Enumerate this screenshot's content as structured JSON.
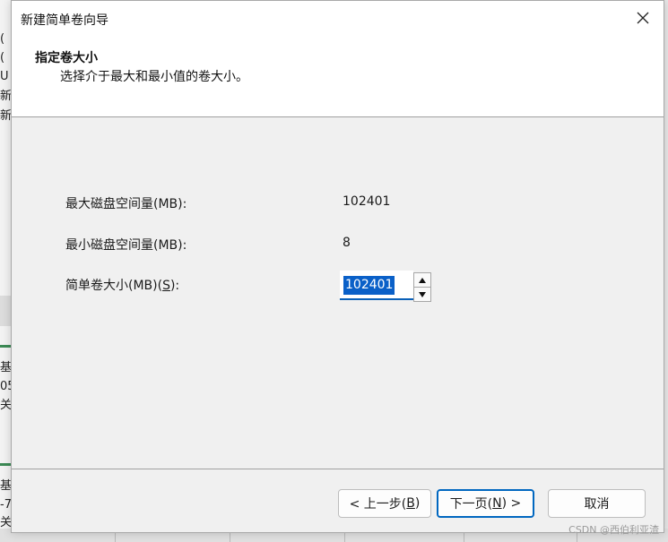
{
  "background": {
    "fragments": [
      "(",
      "(",
      "U",
      "新",
      "新",
      "基",
      "05",
      "关",
      "基",
      "-7",
      "关"
    ],
    "watermark": "CSDN @西伯利亚渣"
  },
  "dialog": {
    "title": "新建简单卷向导",
    "heading": "指定卷大小",
    "subheading": "选择介于最大和最小值的卷大小。",
    "max_label": "最大磁盘空间量(MB):",
    "max_value": "102401",
    "min_label": "最小磁盘空间量(MB):",
    "min_value": "8",
    "size_label_main": "简单卷大小(MB)(",
    "size_label_accel": "S",
    "size_label_end": "):",
    "size_value": "102401",
    "back_button": "< 上一步(",
    "back_accel": "B",
    "back_end": ")",
    "next_button": "下一页(",
    "next_accel": "N",
    "next_end": ") >",
    "cancel_button": "取消"
  },
  "icons": {
    "close": "close-icon",
    "spin_up": "arrow-up-icon",
    "spin_down": "arrow-down-icon"
  },
  "colors": {
    "accent": "#0067c0",
    "selection": "#0a60c8"
  }
}
